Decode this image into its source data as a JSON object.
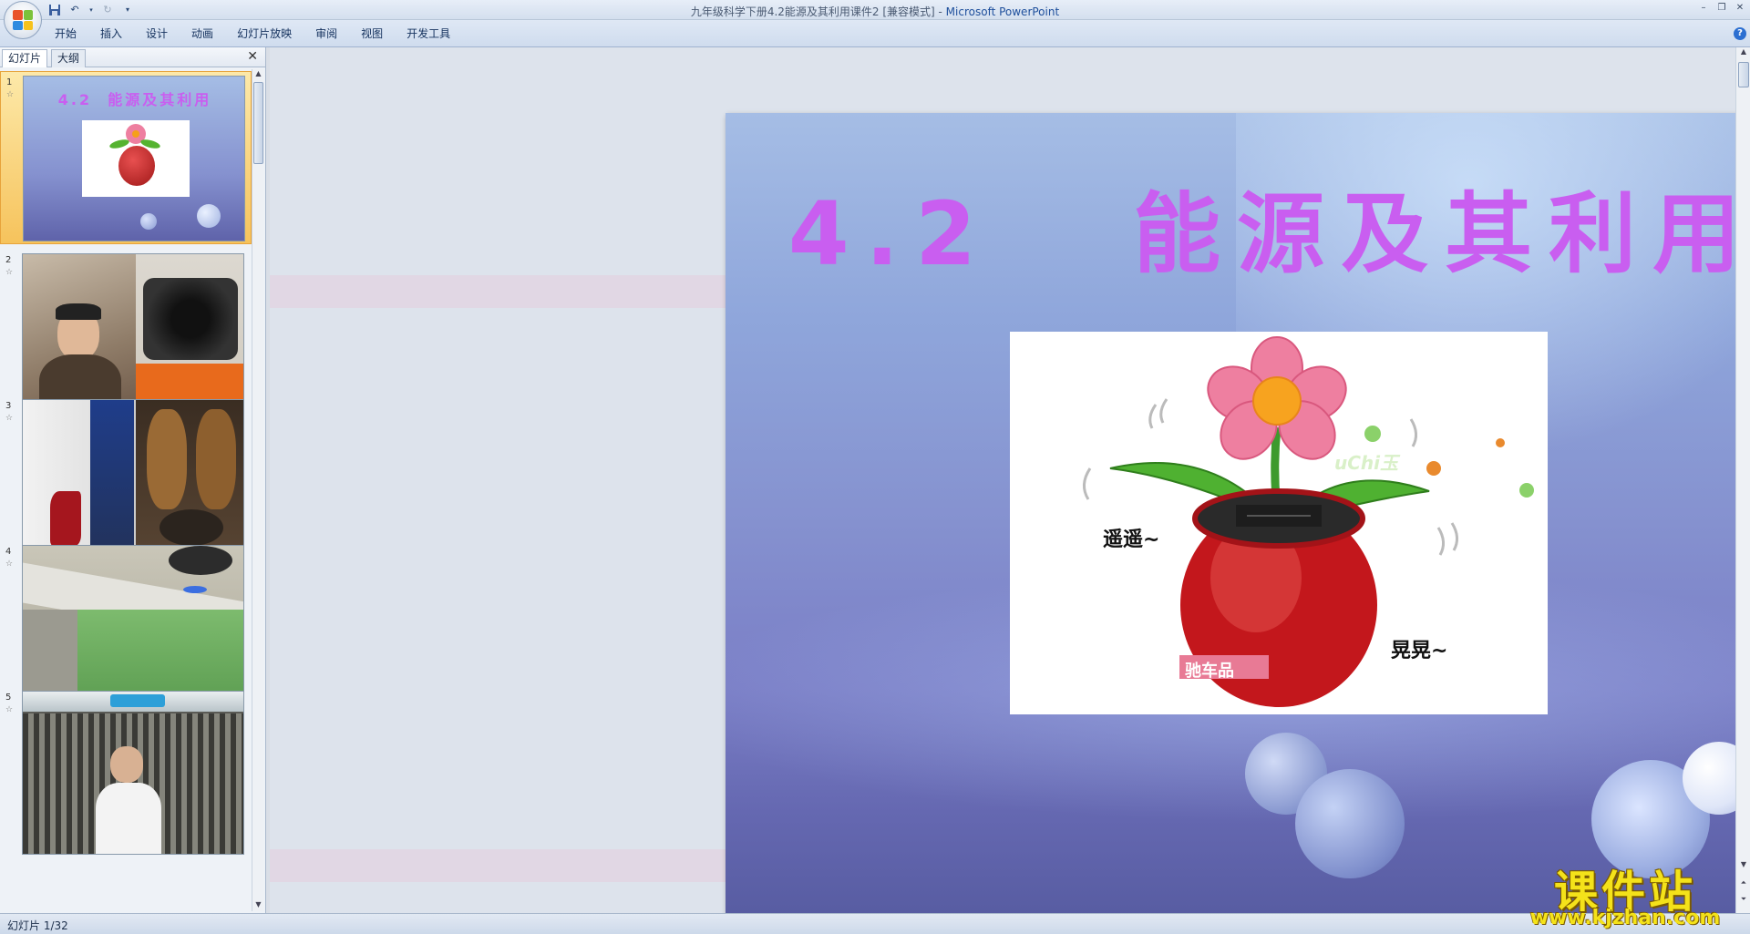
{
  "window": {
    "title_doc": "九年级科学下册4.2能源及其利用课件2 [兼容模式] - ",
    "title_app": "Microsoft PowerPoint"
  },
  "qat": {
    "save_icon": "save-icon",
    "undo_icon": "undo-icon",
    "redo_icon": "redo-icon",
    "customize_icon": "customize-qat-icon"
  },
  "ribbon": {
    "tabs": [
      "开始",
      "插入",
      "设计",
      "动画",
      "幻灯片放映",
      "审阅",
      "视图",
      "开发工具"
    ]
  },
  "panel": {
    "tab_slides": "幻灯片",
    "tab_outline": "大纲",
    "thumbnails": [
      {
        "num": "1",
        "title": "4.2  能源及其利用"
      },
      {
        "num": "2"
      },
      {
        "num": "3"
      },
      {
        "num": "4"
      },
      {
        "num": "5"
      }
    ]
  },
  "slide": {
    "title": "4.2   能源及其利用",
    "caption_left": "遥遥~",
    "caption_right": "晃晃~",
    "pot_label": "驰车品",
    "leaf_label": "uChi玉"
  },
  "status": {
    "slide_info": "幻灯片 1/32"
  },
  "watermark": {
    "brand": "课件站",
    "url": "www.kjzhan.com"
  },
  "colors": {
    "title_purple": "#c95ef0",
    "selection": "#f6c35c",
    "watermark_yellow": "#f4e21a"
  }
}
